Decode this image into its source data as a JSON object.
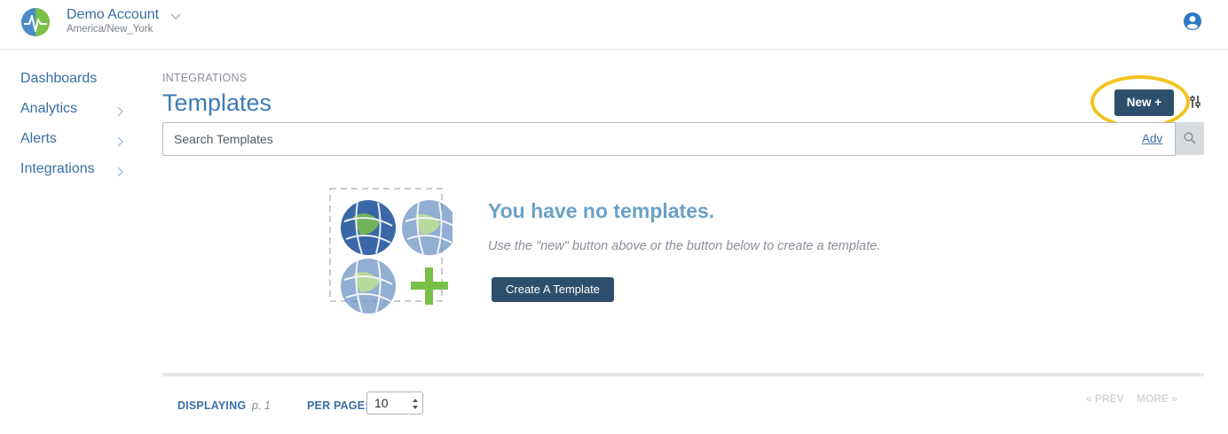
{
  "header": {
    "account_name": "Demo Account",
    "timezone": "America/New_York",
    "logo_icon": "waveform-globe-logo",
    "user_icon": "user-circle-icon",
    "colors": {
      "brand": "#3c6ea5"
    }
  },
  "sidebar": {
    "items": [
      {
        "label": "Dashboards",
        "has_chevron": false
      },
      {
        "label": "Analytics",
        "has_chevron": true
      },
      {
        "label": "Alerts",
        "has_chevron": true
      },
      {
        "label": "Integrations",
        "has_chevron": true
      }
    ]
  },
  "main": {
    "breadcrumb": "INTEGRATIONS",
    "title": "Templates",
    "new_button_label": "New +",
    "search": {
      "placeholder": "Search Templates",
      "value": "",
      "adv_label": "Adv"
    },
    "empty_state": {
      "title": "You have no templates.",
      "description": "Use the \"new\" button above or the button below to create a template.",
      "button_label": "Create A Template"
    }
  },
  "footer": {
    "displaying_label": "DISPLAYING",
    "page": "p. 1",
    "per_page_label": "PER PAGE:",
    "per_page_value": "10",
    "prev_label": "« PREV",
    "more_label": "MORE »"
  },
  "accent_colors": {
    "primary_button": "#2e4f6c",
    "highlight": "#f3c21c",
    "title": "#3d7bb5"
  }
}
